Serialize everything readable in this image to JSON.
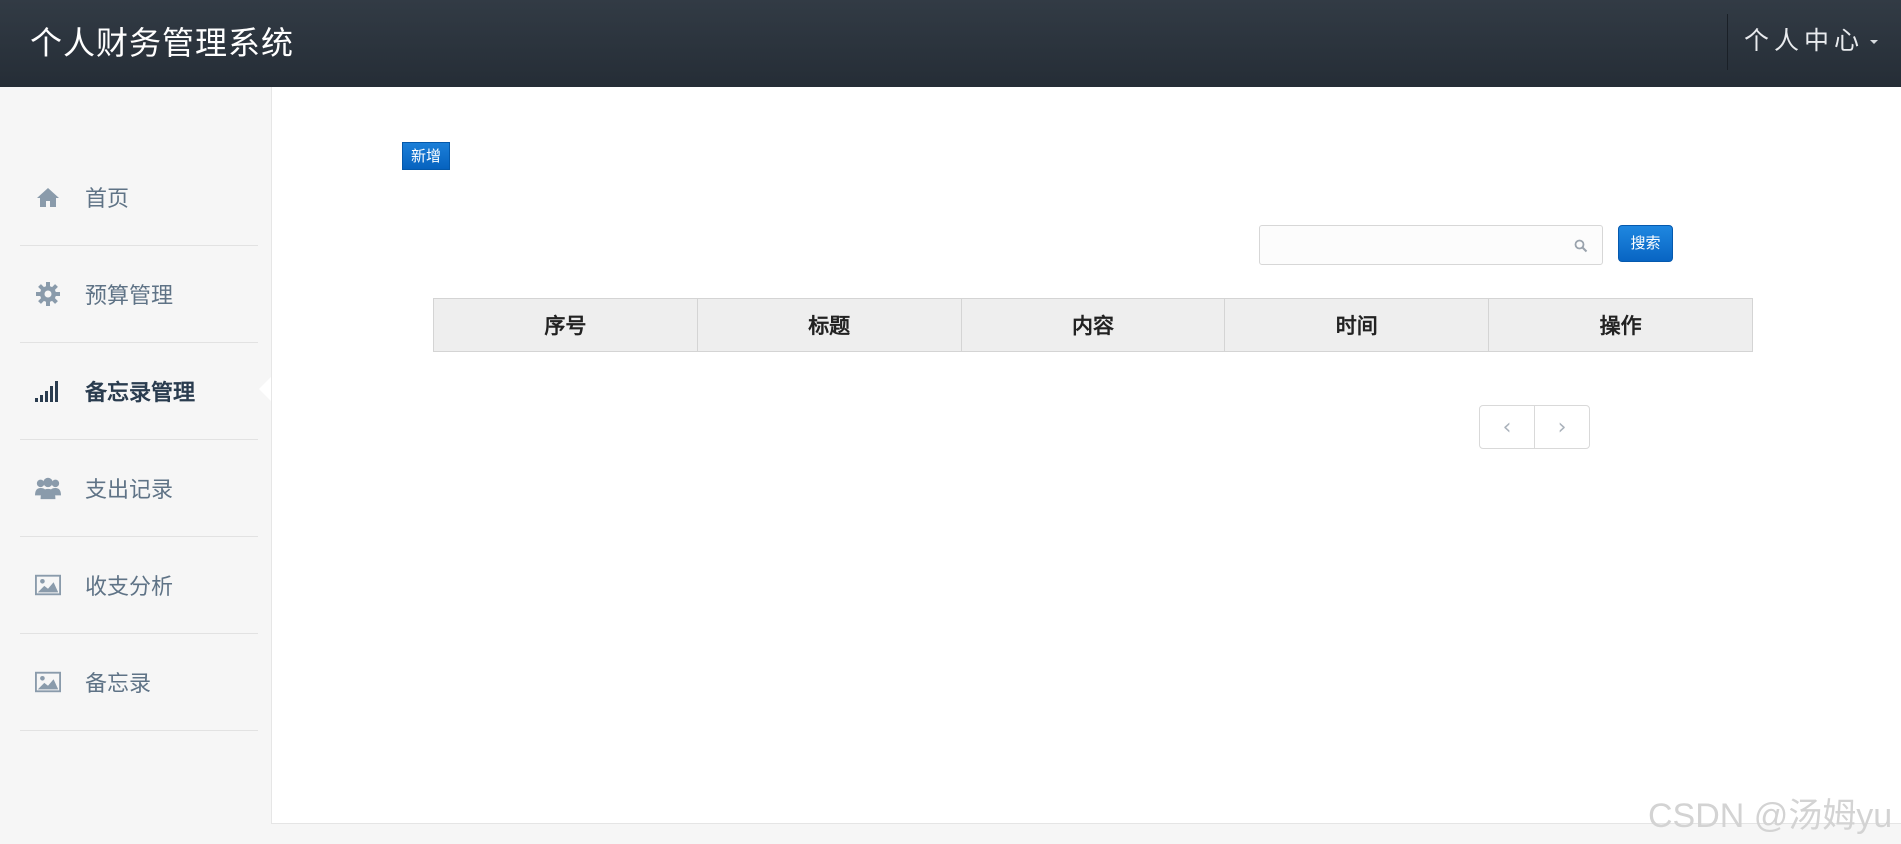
{
  "app": {
    "title": "个人财务管理系统"
  },
  "header": {
    "user_menu": "个人中心"
  },
  "sidebar": {
    "items": [
      {
        "label": "首页",
        "icon": "home-icon",
        "active": false
      },
      {
        "label": "预算管理",
        "icon": "gear-icon",
        "active": false
      },
      {
        "label": "备忘录管理",
        "icon": "signal-bars-icon",
        "active": true
      },
      {
        "label": "支出记录",
        "icon": "users-icon",
        "active": false
      },
      {
        "label": "收支分析",
        "icon": "image-icon",
        "active": false
      },
      {
        "label": "备忘录",
        "icon": "image-icon",
        "active": false
      }
    ]
  },
  "main": {
    "add_button": "新增",
    "search": {
      "placeholder": "",
      "value": "",
      "button": "搜索"
    },
    "table": {
      "columns": [
        "序号",
        "标题",
        "内容",
        "时间",
        "操作"
      ],
      "rows": []
    },
    "pagination": {
      "prev": "‹",
      "next": "›"
    }
  },
  "watermark": "CSDN @汤姆yu",
  "colors": {
    "header": "#2b333d",
    "primary": "#0a6ac8",
    "sidebar_text": "#5f7386",
    "active_text": "#2a3c4f"
  }
}
